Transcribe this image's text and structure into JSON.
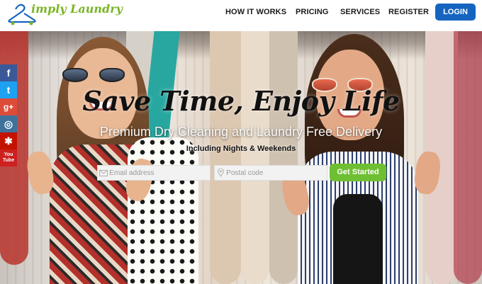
{
  "brand": {
    "name": "imply Laundry",
    "accent": "#7ab526"
  },
  "nav": {
    "items": [
      {
        "label": "HOW IT WORKS"
      },
      {
        "label": "PRICING"
      },
      {
        "label": "SERVICES"
      },
      {
        "label": "REGISTER"
      }
    ],
    "login_label": "LOGIN",
    "login_color": "#1565c0"
  },
  "hero": {
    "headline": "Save Time, Enjoy Life",
    "subheadline": "Premium Dry Cleaning and Laundry Free Delivery",
    "tagline": "Including Nights & Weekends",
    "email_placeholder": "Email address",
    "postal_placeholder": "Postal code",
    "cta_label": "Get Started",
    "cta_color": "#6fbf32"
  },
  "social": [
    {
      "icon": "facebook-icon",
      "glyph": "f",
      "color": "#3b5998"
    },
    {
      "icon": "twitter-icon",
      "glyph": "t",
      "color": "#1da1f2"
    },
    {
      "icon": "google-plus-icon",
      "glyph": "g+",
      "color": "#dd4b39"
    },
    {
      "icon": "instagram-icon",
      "glyph": "◎",
      "color": "#3f729b"
    },
    {
      "icon": "yelp-icon",
      "glyph": "✱",
      "color": "#c41200"
    },
    {
      "icon": "youtube-icon",
      "glyph": "You Tube",
      "color": "#cd201f"
    }
  ]
}
